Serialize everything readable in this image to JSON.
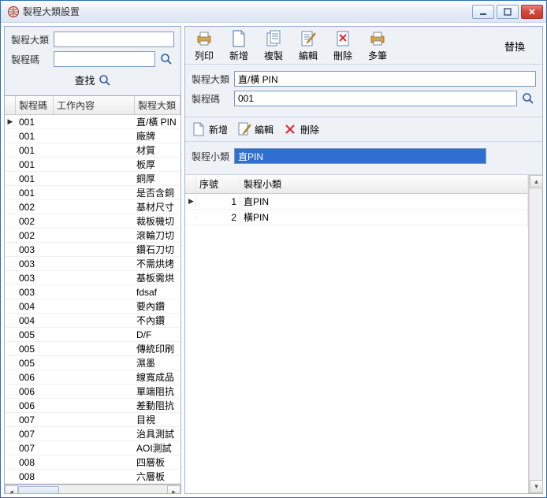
{
  "window": {
    "title": "製程大類設置"
  },
  "win_btns": {
    "min": "minimize",
    "max": "maximize",
    "close": "close"
  },
  "left": {
    "label_category": "製程大類",
    "label_code": "製程碼",
    "value_category": "",
    "value_code": "",
    "search_btn": "查找",
    "headers": {
      "code": "製程碼",
      "work": "工作內容",
      "category": "製程大類"
    },
    "rows": [
      {
        "code": "001",
        "work": "",
        "category": "直/橫 PIN",
        "active": true
      },
      {
        "code": "001",
        "work": "",
        "category": "廠牌"
      },
      {
        "code": "001",
        "work": "",
        "category": "材質"
      },
      {
        "code": "001",
        "work": "",
        "category": "板厚"
      },
      {
        "code": "001",
        "work": "",
        "category": "銅厚"
      },
      {
        "code": "001",
        "work": "",
        "category": "是否含銅"
      },
      {
        "code": "002",
        "work": "",
        "category": "基材尺寸"
      },
      {
        "code": "002",
        "work": "",
        "category": "裁板機切"
      },
      {
        "code": "002",
        "work": "",
        "category": "滾輪刀切"
      },
      {
        "code": "003",
        "work": "",
        "category": "鑽石刀切"
      },
      {
        "code": "003",
        "work": "",
        "category": "不需烘烤"
      },
      {
        "code": "003",
        "work": "",
        "category": "基板需烘"
      },
      {
        "code": "003",
        "work": "",
        "category": "fdsaf"
      },
      {
        "code": "004",
        "work": "",
        "category": "要內鑽"
      },
      {
        "code": "004",
        "work": "",
        "category": "不內鑽"
      },
      {
        "code": "005",
        "work": "",
        "category": "D/F"
      },
      {
        "code": "005",
        "work": "",
        "category": "傳統印刷"
      },
      {
        "code": "005",
        "work": "",
        "category": "濕墨"
      },
      {
        "code": "006",
        "work": "",
        "category": "線寬成品"
      },
      {
        "code": "006",
        "work": "",
        "category": "單端阻抗"
      },
      {
        "code": "006",
        "work": "",
        "category": "差動阻抗"
      },
      {
        "code": "007",
        "work": "",
        "category": "目視"
      },
      {
        "code": "007",
        "work": "",
        "category": "治具測試"
      },
      {
        "code": "007",
        "work": "",
        "category": "AOI測試"
      },
      {
        "code": "008",
        "work": "",
        "category": "四層板"
      },
      {
        "code": "008",
        "work": "",
        "category": "六層板"
      }
    ]
  },
  "toolbar": {
    "print": "列印",
    "add": "新增",
    "copy": "複製",
    "edit": "編輯",
    "delete": "刪除",
    "multi": "多筆",
    "replace": "替換"
  },
  "detail": {
    "label_category": "製程大類",
    "category_value": "直/橫 PIN",
    "label_code": "製程碼",
    "code_value": "001"
  },
  "subtoolbar": {
    "add": "新增",
    "edit": "編輯",
    "delete": "刪除"
  },
  "subform": {
    "label": "製程小類",
    "value": "直PIN"
  },
  "subgrid": {
    "head_seq": "序號",
    "head_name": "製程小類",
    "rows": [
      {
        "seq": "1",
        "name": "直PIN",
        "active": true
      },
      {
        "seq": "2",
        "name": "橫PIN"
      }
    ]
  }
}
